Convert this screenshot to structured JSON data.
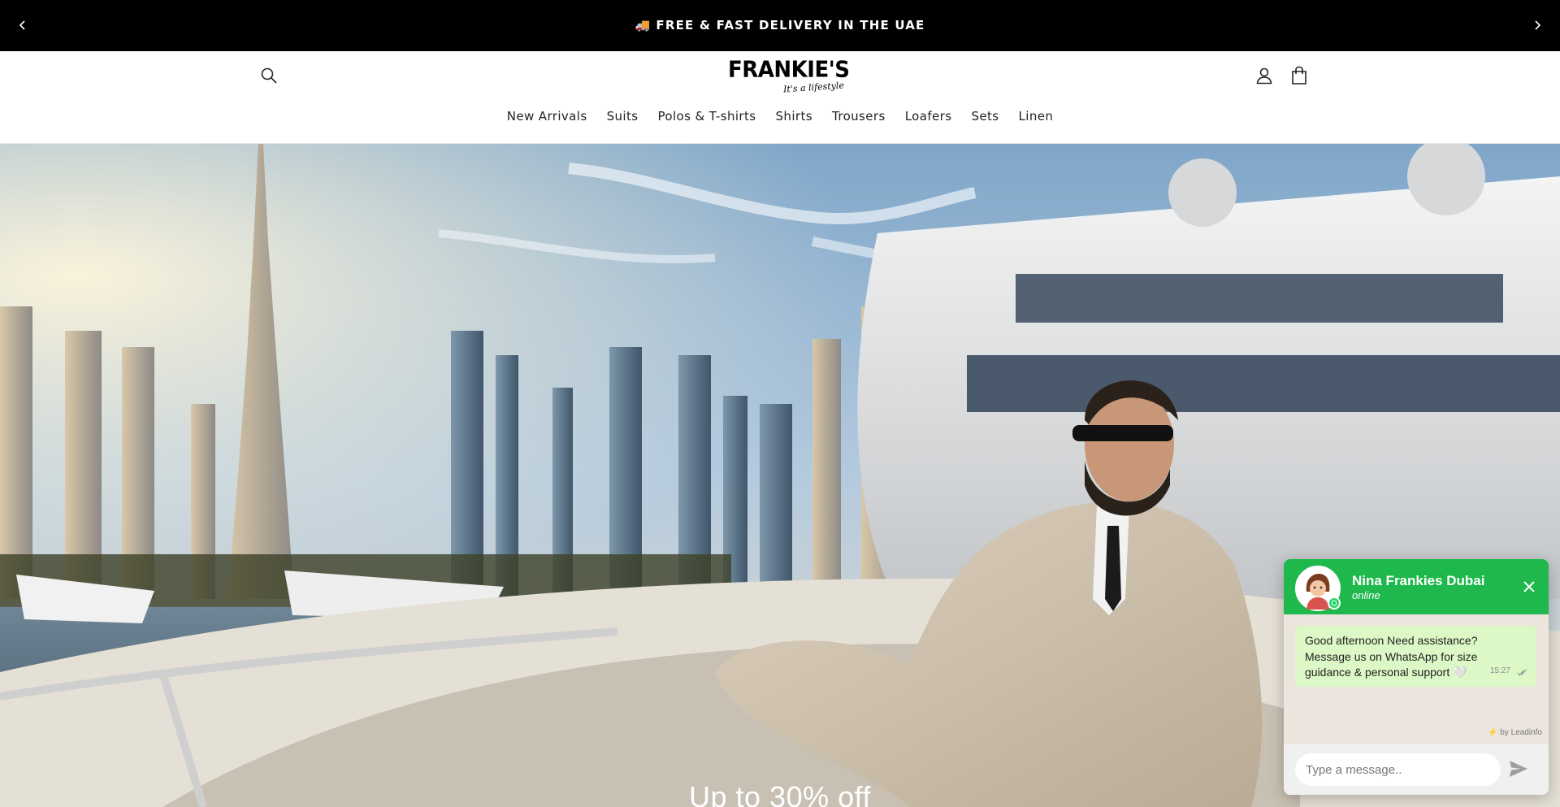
{
  "announcement": {
    "text": "FREE & FAST DELIVERY IN THE UAE",
    "truck_icon": "🚚",
    "prev_icon": "chevron-left-icon",
    "next_icon": "chevron-right-icon"
  },
  "header": {
    "logo_word": "FRANKIE'S",
    "logo_tagline": "It's a lifestyle",
    "icons": [
      "search-icon",
      "account-icon",
      "cart-icon"
    ]
  },
  "nav": {
    "items": [
      "New Arrivals",
      "Suits",
      "Polos & T-shirts",
      "Shirts",
      "Trousers",
      "Loafers",
      "Sets",
      "Linen"
    ]
  },
  "hero": {
    "headline": "Up to 30% off"
  },
  "chat": {
    "name": "Nina Frankies Dubai",
    "status": "online",
    "message": "Good afternoon Need assistance? Message us on WhatsApp for size guidance & personal support 🤍",
    "time": "15:27",
    "powered_by": "by Leadinfo",
    "input_placeholder": "Type a message..",
    "accent_color": "#1fb84c",
    "bubble_color": "#dcf8c6"
  }
}
